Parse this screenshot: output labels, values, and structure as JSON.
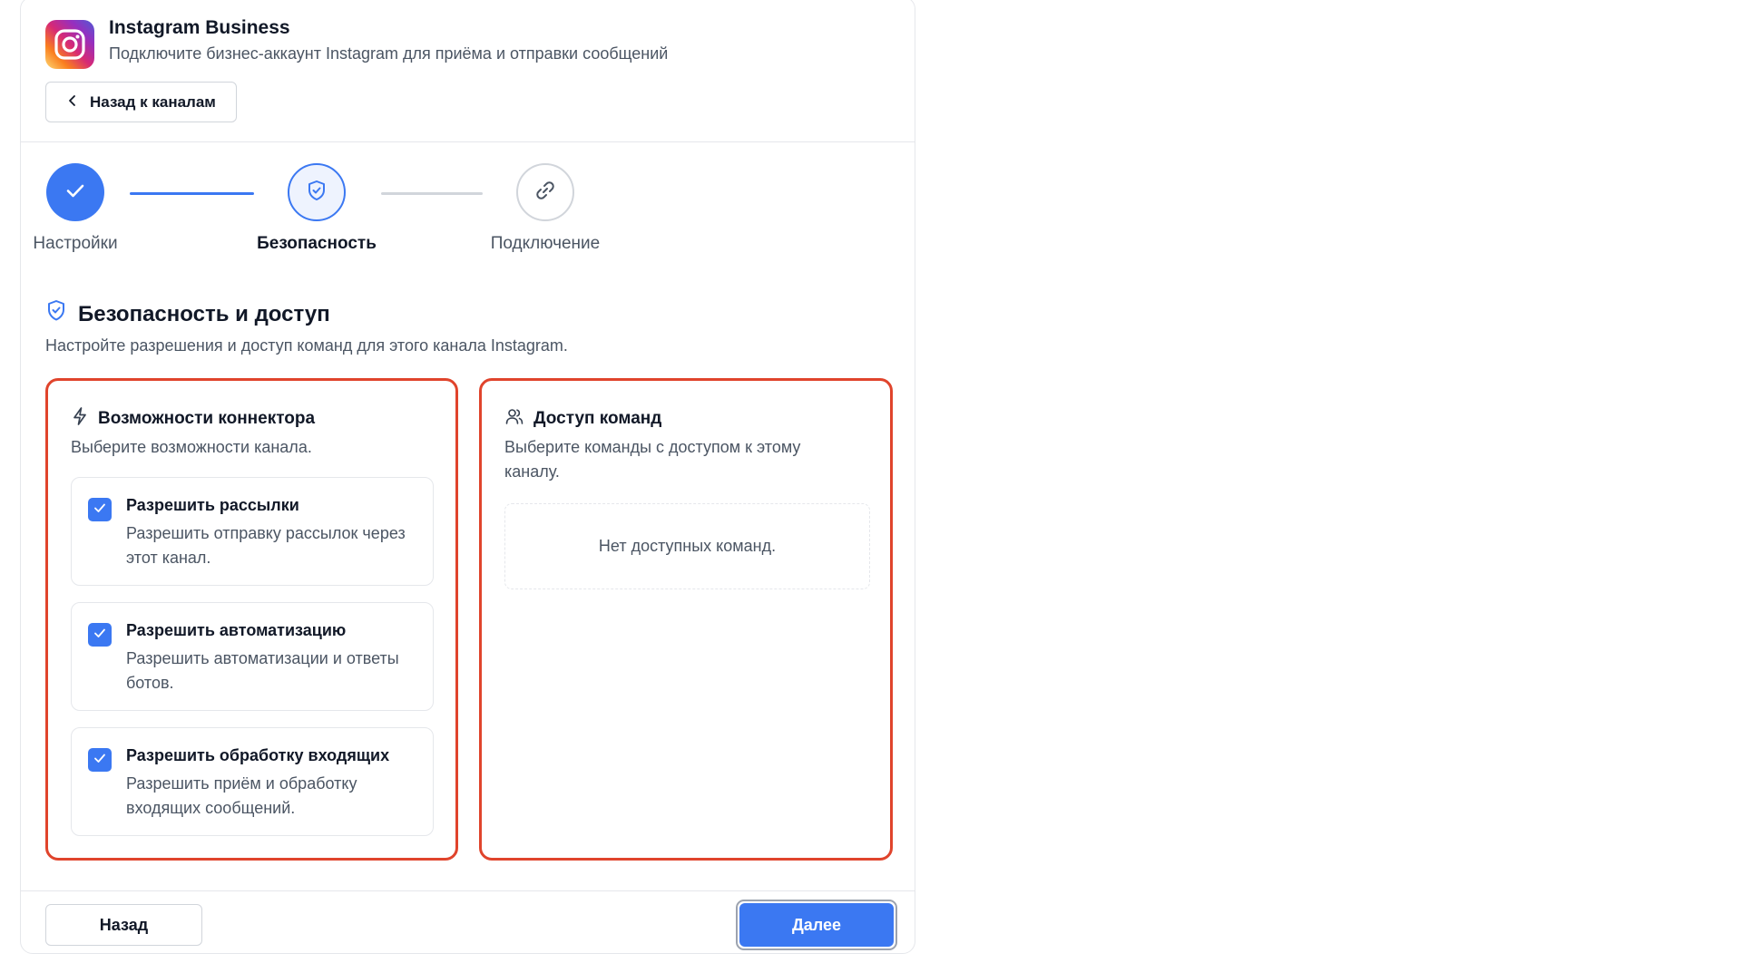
{
  "header": {
    "title": "Instagram Business",
    "subtitle": "Подключите бизнес-аккаунт Instagram для приёма и отправки сообщений",
    "back_label": "Назад к каналам"
  },
  "steps": [
    {
      "label": "Настройки",
      "state": "done",
      "icon": "check-icon"
    },
    {
      "label": "Безопасность",
      "state": "active",
      "icon": "shield-icon"
    },
    {
      "label": "Подключение",
      "state": "todo",
      "icon": "link-icon"
    }
  ],
  "section": {
    "title": "Безопасность и доступ",
    "description": "Настройте разрешения и доступ команд для этого канала Instagram."
  },
  "capabilities": {
    "title": "Возможности коннектора",
    "description": "Выберите возможности канала.",
    "options": [
      {
        "title": "Разрешить рассылки",
        "description": "Разрешить отправку рассылок через этот канал.",
        "checked": true
      },
      {
        "title": "Разрешить автоматизацию",
        "description": "Разрешить автоматизации и ответы ботов.",
        "checked": true
      },
      {
        "title": "Разрешить обработку входящих",
        "description": "Разрешить приём и обработку входящих сообщений.",
        "checked": true
      }
    ]
  },
  "team_access": {
    "title": "Доступ команд",
    "description": "Выберите команды с доступом к этому каналу.",
    "empty_text": "Нет доступных команд."
  },
  "footer": {
    "back_label": "Назад",
    "next_label": "Далее"
  },
  "colors": {
    "accent": "#3b78f2",
    "highlight_border": "#e0442c"
  }
}
